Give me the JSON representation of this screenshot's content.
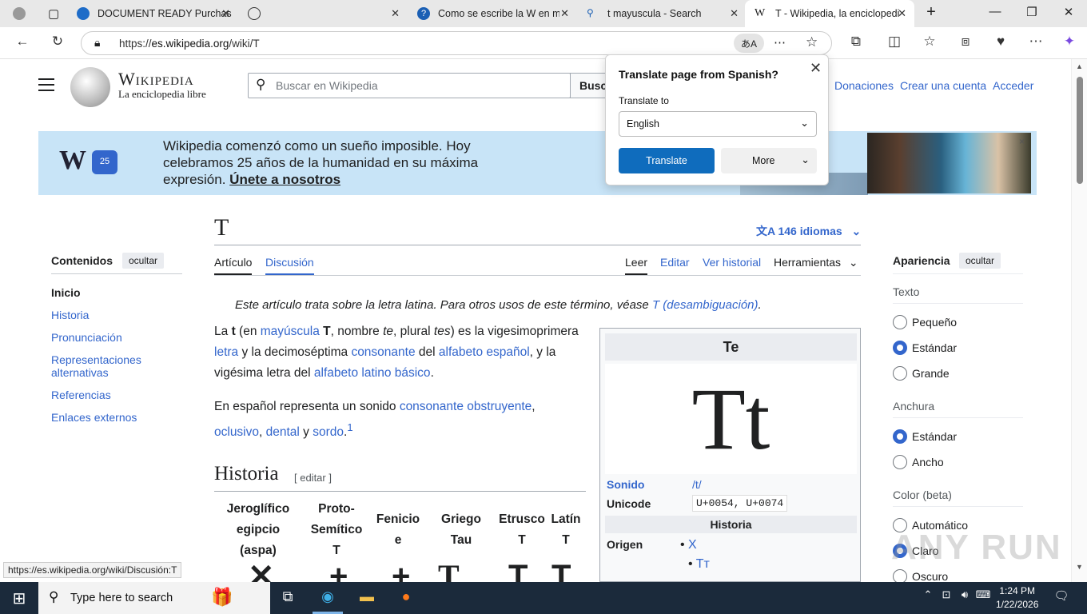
{
  "browser": {
    "tabs": [
      {
        "title": "DOCUMENT READY Purchas",
        "icon": "copilot-icon"
      },
      {
        "title": "",
        "icon": "globe-icon"
      },
      {
        "title": "Como se escribe la W en ma",
        "icon": "help-icon"
      },
      {
        "title": "t mayuscula - Search",
        "icon": "search-icon"
      },
      {
        "title": "T - Wikipedia, la enciclopedi",
        "icon": "wikipedia-icon"
      }
    ],
    "url_prefix": "https://",
    "url_host": "es.wikipedia.org",
    "url_path": "/wiki/T",
    "status_url": "https://es.wikipedia.org/wiki/Discusión:T"
  },
  "translate_popup": {
    "title": "Translate page from Spanish?",
    "translate_to_label": "Translate to",
    "selected_language": "English",
    "translate_button": "Translate",
    "more_button": "More"
  },
  "wiki": {
    "wordmark": "Wikipedia",
    "tagline": "La enciclopedia libre",
    "search_placeholder": "Buscar en Wikipedia",
    "search_button": "Buscar",
    "top_links": [
      "Donaciones",
      "Crear una cuenta",
      "Acceder"
    ],
    "banner": {
      "logo_text": "W",
      "logo_badge": "25",
      "text": "Wikipedia comenzó como un sueño imposible. Hoy celebramos 25 años de la humanidad en su máxima expresión.",
      "link": "Únete a nosotros",
      "close": "×"
    },
    "page_title": "T",
    "languages": "146 idiomas",
    "tabs_left": [
      "Artículo",
      "Discusión"
    ],
    "tabs_right": [
      "Leer",
      "Editar",
      "Ver historial",
      "Herramientas"
    ],
    "toc": {
      "heading": "Contenidos",
      "hide": "ocultar",
      "items": [
        "Inicio",
        "Historia",
        "Pronunciación",
        "Representaciones alternativas",
        "Referencias",
        "Enlaces externos"
      ]
    },
    "hatnote_prefix": "Este artículo trata sobre la letra latina. Para otros usos de este término, véase ",
    "hatnote_link": "T (desambiguación)",
    "hatnote_suffix": ".",
    "para1": {
      "a": "La ",
      "b": "t",
      "c": " (en ",
      "d": "mayúscula",
      "e": " ",
      "f": "T",
      "g": ", nombre ",
      "h": "te",
      "i": ", plural ",
      "j": "tes",
      "k": ") es la vigesimoprimera ",
      "l": "letra",
      "m": " y la decimoséptima ",
      "n": "consonante",
      "o": " del ",
      "p": "alfabeto español",
      "q": ", y la vigésima letra del ",
      "r": "alfabeto latino básico",
      "s": "."
    },
    "para2": {
      "a": "En español representa un sonido ",
      "b": "consonante obstruyente",
      "c": ", ",
      "d": "oclusivo",
      "e": ", ",
      "f": "dental",
      "g": " y ",
      "h": "sordo",
      "i": ".",
      "sup": "1"
    },
    "history_heading": "Historia",
    "history_edit": "[ editar ]",
    "history_columns": [
      "Jeroglífico egipcio (aspa)",
      "Proto-Semítico T",
      "Fenicio e",
      "Griego Tau",
      "Etrusco T",
      "Latín T"
    ],
    "infobox": {
      "title": "Te",
      "big": "Tt",
      "sound_label": "Sonido",
      "sound_value": "/t/",
      "unicode_label": "Unicode",
      "unicode_value": "U+0054, U+0074",
      "history_label": "Historia",
      "origin_label": "Origen",
      "origin_items": [
        "X",
        "Tт"
      ]
    },
    "appearance": {
      "heading": "Apariencia",
      "hide": "ocultar",
      "text_label": "Texto",
      "text_options": [
        "Pequeño",
        "Estándar",
        "Grande"
      ],
      "width_label": "Anchura",
      "width_options": [
        "Estándar",
        "Ancho"
      ],
      "color_label": "Color (beta)",
      "color_options": [
        "Automático",
        "Claro",
        "Oscuro"
      ]
    }
  },
  "taskbar": {
    "search_placeholder": "Type here to search",
    "time": "1:24 PM",
    "date": "1/22/2026"
  },
  "watermark": "ANY RUN"
}
